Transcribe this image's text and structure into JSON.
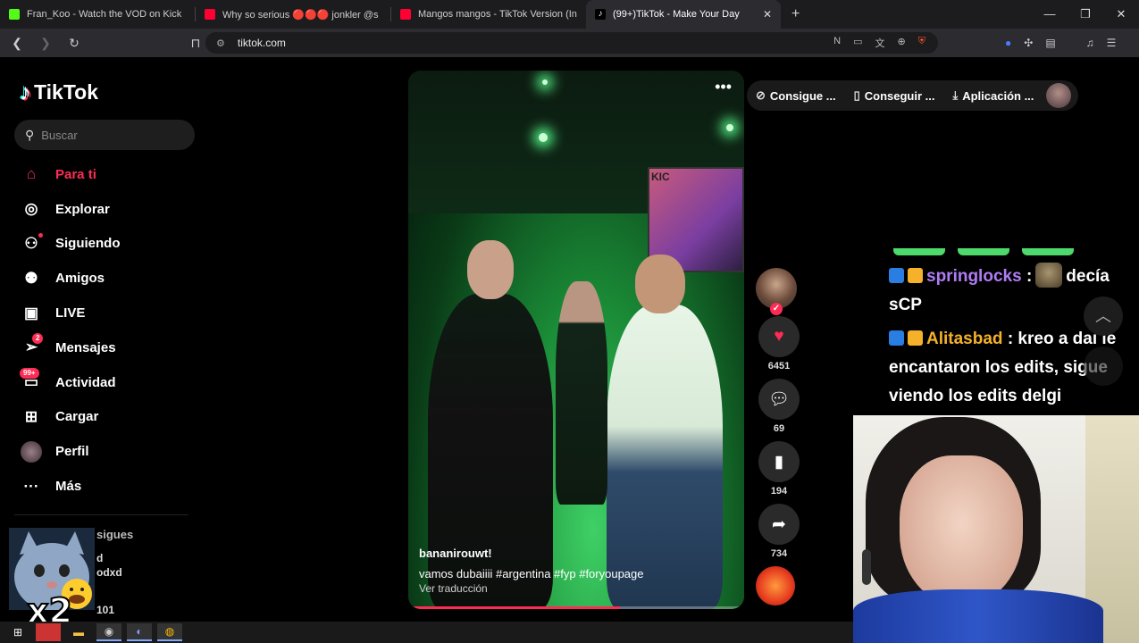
{
  "browser": {
    "tabs": [
      {
        "title": "Fran_Koo - Watch the VOD on Kick",
        "favicon_color": "#53fc18"
      },
      {
        "title": "Why so serious 🔴🔴🔴 jonkler @s",
        "favicon_color": "#ff0033"
      },
      {
        "title": "Mangos mangos - TikTok Version (In",
        "favicon_color": "#ff0033"
      },
      {
        "title": "(99+)TikTok - Make Your Day",
        "favicon_color": "#ffffff",
        "active": true
      }
    ],
    "new_tab": "+",
    "url": "tiktok.com",
    "window_controls": {
      "minimize": "—",
      "restore": "❐",
      "close": "✕"
    }
  },
  "sidebar": {
    "logo_text": "TikTok",
    "search_placeholder": "Buscar",
    "nav": [
      {
        "label": "Para ti",
        "icon": "home-icon",
        "active": true
      },
      {
        "label": "Explorar",
        "icon": "compass-icon"
      },
      {
        "label": "Siguiendo",
        "icon": "following-icon"
      },
      {
        "label": "Amigos",
        "icon": "friends-icon"
      },
      {
        "label": "LIVE",
        "icon": "live-icon"
      },
      {
        "label": "Mensajes",
        "icon": "messages-icon",
        "badge": "2"
      },
      {
        "label": "Actividad",
        "icon": "activity-icon",
        "badge": "99+"
      },
      {
        "label": "Cargar",
        "icon": "upload-icon"
      },
      {
        "label": "Perfil",
        "icon": "profile-icon"
      },
      {
        "label": "Más",
        "icon": "more-icon"
      }
    ],
    "following_title": "sigues",
    "following": [
      "d",
      "odxd",
      "101"
    ]
  },
  "overlay": {
    "multiplier": "x2"
  },
  "video": {
    "screen_text": "KIC",
    "username": "bananirouwt!",
    "caption": "vamos dubaiiii #argentina #fyp #foryoupage",
    "translate": "Ver traducción",
    "progress": 0.63
  },
  "actions": {
    "likes": "6451",
    "comments": "69",
    "saves": "194",
    "shares": "734"
  },
  "top_buttons": [
    "Consigue ...",
    "Conseguir ...",
    "Aplicación ..."
  ],
  "chat": {
    "messages": [
      {
        "user": "springlocks",
        "text_before": "",
        "text": "decía sCP"
      },
      {
        "user": "Alitasbad",
        "text": "kreo a dai le encantaron los edits, sigue viendo los edits delgi"
      }
    ],
    "separator": ":"
  },
  "colors": {
    "accent": "#fe2c55",
    "chat_name1": "#b07cf5",
    "chat_name2": "#f5b12a"
  }
}
